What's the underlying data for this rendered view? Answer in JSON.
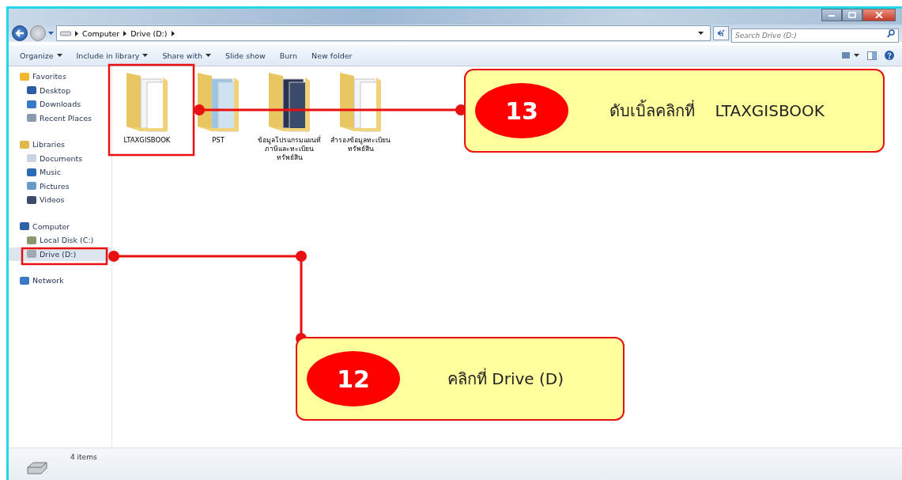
{
  "address_bar": {
    "path": [
      "Computer",
      "Drive (D:)"
    ]
  },
  "search": {
    "placeholder": "Search Drive (D:)"
  },
  "toolbar": [
    {
      "label": "Organize",
      "dropdown": true
    },
    {
      "label": "Include in library",
      "dropdown": true
    },
    {
      "label": "Share with",
      "dropdown": true
    },
    {
      "label": "Slide show",
      "dropdown": false
    },
    {
      "label": "Burn",
      "dropdown": false
    },
    {
      "label": "New folder",
      "dropdown": false
    }
  ],
  "sidebar": {
    "groups": [
      {
        "label": "Favorites",
        "children": [
          {
            "label": "Desktop",
            "selected": false
          },
          {
            "label": "Downloads",
            "selected": false
          },
          {
            "label": "Recent Places",
            "selected": false
          }
        ]
      },
      {
        "label": "Libraries",
        "children": [
          {
            "label": "Documents",
            "selected": false
          },
          {
            "label": "Music",
            "selected": false
          },
          {
            "label": "Pictures",
            "selected": false
          },
          {
            "label": "Videos",
            "selected": false
          }
        ]
      },
      {
        "label": "Computer",
        "children": [
          {
            "label": "Local Disk (C:)",
            "selected": false
          },
          {
            "label": "Drive (D:)",
            "selected": true
          }
        ]
      },
      {
        "label": "Network"
      }
    ]
  },
  "files": [
    {
      "name": "LTAXGISBOOK",
      "kind": "documents"
    },
    {
      "name": "PST",
      "kind": "pictures"
    },
    {
      "name": "ข้อมูลโปรแกรมแผนที่ภาษีและทะเบียนทรัพย์สิน",
      "kind": "photo"
    },
    {
      "name": "สำรองข้อมูลทะเบียนทรัพย์สิน",
      "kind": "documents"
    }
  ],
  "status_bar": {
    "text": "4 items"
  },
  "annotations": [
    {
      "number": "13",
      "text": "ดับเบิ้ลคลิกที่    LTAXGISBOOK"
    },
    {
      "number": "12",
      "text": "คลิกที่ Drive (D)"
    }
  ]
}
